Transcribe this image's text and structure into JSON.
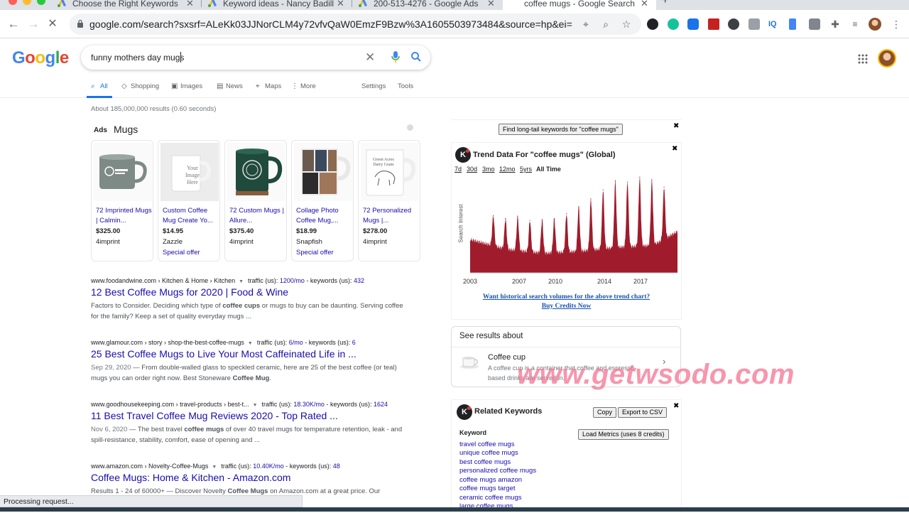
{
  "browser": {
    "tabs": [
      {
        "title": "Choose the Right Keywords w",
        "active": false
      },
      {
        "title": "Keyword ideas - Nancy Badillo",
        "active": false
      },
      {
        "title": "200-513-4276 - Google Ads",
        "active": false
      },
      {
        "title": "coffee mugs - Google Search",
        "active": true
      }
    ],
    "url": "google.com/search?sxsrf=ALeKk03JJNorCLM4y72vfvQaW0EmzF9Bzw%3A1605503973484&source=hp&ei=5Qu...",
    "new_tab_glyph": "+",
    "close_glyph": "✕"
  },
  "google": {
    "logo": [
      "G",
      "o",
      "o",
      "g",
      "l",
      "e"
    ],
    "logo_colors": [
      "#4285f4",
      "#ea4335",
      "#fbbc05",
      "#4285f4",
      "#34a853",
      "#ea4335"
    ],
    "query": "funny mothers day mugs",
    "clear_glyph": "✕",
    "tabs": [
      {
        "label": "All",
        "icon": "search-icon",
        "glyph": "⌕"
      },
      {
        "label": "Shopping",
        "icon": "tag-icon",
        "glyph": "◇"
      },
      {
        "label": "Images",
        "icon": "image-icon",
        "glyph": "▣"
      },
      {
        "label": "News",
        "icon": "news-icon",
        "glyph": "▤"
      },
      {
        "label": "Maps",
        "icon": "pin-icon",
        "glyph": "⌖"
      },
      {
        "label": "More",
        "icon": "more-icon",
        "glyph": "⋮"
      }
    ],
    "settings": "Settings",
    "tools": "Tools",
    "stats": "About 185,000,000 results (0.60 seconds)"
  },
  "ads": {
    "label": "Ads",
    "heading": "Mugs",
    "cards": [
      {
        "title": "72 Imprinted Mugs | Calmin...",
        "price": "$325.00",
        "seller": "4imprint",
        "offer": ""
      },
      {
        "title": "Custom Coffee Mug Create Yo...",
        "price": "$14.95",
        "seller": "Zazzle",
        "offer": "Special offer"
      },
      {
        "title": "72 Custom Mugs | Allure...",
        "price": "$375.40",
        "seller": "4imprint",
        "offer": ""
      },
      {
        "title": "Collage Photo Coffee Mug,...",
        "price": "$18.99",
        "seller": "Snapfish",
        "offer": "Special offer"
      },
      {
        "title": "72 Personalized Mugs |...",
        "price": "$278.00",
        "seller": "4imprint",
        "offer": ""
      }
    ],
    "card2_mug_text": "Your Image Here",
    "card5_mug_text": "Green Acres Dairy Goats"
  },
  "results": [
    {
      "cite": "www.foodandwine.com › Kitchen & Home › Kitchen",
      "traffic_label": "traffic (us):",
      "traffic": "1200/mo",
      "kw_label": "- keywords (us):",
      "keywords": "432",
      "title": "12 Best Coffee Mugs for 2020 | Food & Wine",
      "date": "",
      "snippet_parts": [
        "Factors to Consider. Deciding which type of ",
        "coffee cups",
        " or mugs to buy can be daunting. Serving coffee for the family? Keep a set of quality everyday mugs ..."
      ]
    },
    {
      "cite": "www.glamour.com › story › shop-the-best-coffee-mugs",
      "traffic_label": "traffic (us):",
      "traffic": "6/mo",
      "kw_label": "- keywords (us):",
      "keywords": "6",
      "title": "25 Best Coffee Mugs to Live Your Most Caffeinated Life in ...",
      "date": "Sep 29, 2020",
      "snippet_parts": [
        " — From double-walled glass to speckled ceramic, here are 25 of the best coffee (or teal) mugs you can order right now. Best Stoneware ",
        "Coffee Mug",
        "."
      ]
    },
    {
      "cite": "www.goodhousekeeping.com › travel-products › best-t...",
      "traffic_label": "traffic (us):",
      "traffic": "18.30K/mo",
      "kw_label": "- keywords (us):",
      "keywords": "1624",
      "title": "11 Best Travel Coffee Mug Reviews 2020 - Top Rated ...",
      "date": "Nov 6, 2020",
      "snippet_parts": [
        " — The best travel ",
        "coffee mugs",
        " of over 40 travel mugs for temperature retention, leak - and spill-resistance, stability, comfort, ease of opening and ..."
      ]
    },
    {
      "cite": "www.amazon.com › Novelty-Coffee-Mugs",
      "traffic_label": "traffic (us):",
      "traffic": "10.40K/mo",
      "kw_label": "- keywords (us):",
      "keywords": "48",
      "title": "Coffee Mugs: Home & Kitchen - Amazon.com",
      "date": "",
      "snippet_parts": [
        "Results 1 - 24 of 60000+ — Discover Novelty ",
        "Coffee Mugs",
        " on Amazon.com at a great price. Our"
      ]
    }
  ],
  "kwe": {
    "longtail_button": "Find long-tail keywords for \"coffee mugs\"",
    "close_glyph": "✖",
    "logo_letter": "K",
    "trend_title": "Trend Data For \"coffee mugs\" (Global)",
    "ranges": [
      "7d",
      "30d",
      "3mo",
      "12mo",
      "5yrs",
      "All Time"
    ],
    "y_axis_label": "Search Interest",
    "historical_link": "Want historical search volumes for the above trend chart?",
    "buy_link": "Buy Credits Now",
    "related_title": "Related Keywords",
    "copy": "Copy",
    "export": "Export to CSV",
    "load_metrics": "Load Metrics (uses 8 credits)",
    "keyword_header": "Keyword",
    "keywords": [
      "travel coffee mugs",
      "unique coffee mugs",
      "best coffee mugs",
      "personalized coffee mugs",
      "coffee mugs amazon",
      "coffee mugs target",
      "ceramic coffee mugs",
      "large coffee mugs"
    ]
  },
  "chart_data": {
    "type": "area",
    "title": "Trend Data For \"coffee mugs\" (Global)",
    "ylabel": "Search Interest",
    "xlabel": "",
    "x_ticks": [
      "2003",
      "2007",
      "2010",
      "2014",
      "2017"
    ],
    "x_range": [
      2003,
      2020
    ],
    "ylim": [
      0,
      100
    ],
    "color": "#a01c2c",
    "peaks": [
      {
        "year": 2004.9,
        "value": 58
      },
      {
        "year": 2005.9,
        "value": 55
      },
      {
        "year": 2006.9,
        "value": 57
      },
      {
        "year": 2007.9,
        "value": 53
      },
      {
        "year": 2008.9,
        "value": 54
      },
      {
        "year": 2009.9,
        "value": 55
      },
      {
        "year": 2010.9,
        "value": 60
      },
      {
        "year": 2011.9,
        "value": 67
      },
      {
        "year": 2012.9,
        "value": 75
      },
      {
        "year": 2013.9,
        "value": 84
      },
      {
        "year": 2014.9,
        "value": 93
      },
      {
        "year": 2015.9,
        "value": 92
      },
      {
        "year": 2016.9,
        "value": 97
      },
      {
        "year": 2017.9,
        "value": 94
      },
      {
        "year": 2018.9,
        "value": 87
      }
    ],
    "baseline": [
      {
        "year": 2003.0,
        "value": 34
      },
      {
        "year": 2006.0,
        "value": 24
      },
      {
        "year": 2009.0,
        "value": 20
      },
      {
        "year": 2012.0,
        "value": 22
      },
      {
        "year": 2015.0,
        "value": 26
      },
      {
        "year": 2018.0,
        "value": 28
      },
      {
        "year": 2020.0,
        "value": 42
      }
    ]
  },
  "knowledge": {
    "heading": "See results about",
    "name": "Coffee cup",
    "description": "A coffee cup is a container that coffee and espresso-based drinks are served in.",
    "chevron": "›"
  },
  "watermark": "www.getwsodo.com",
  "status": "Processing request..."
}
